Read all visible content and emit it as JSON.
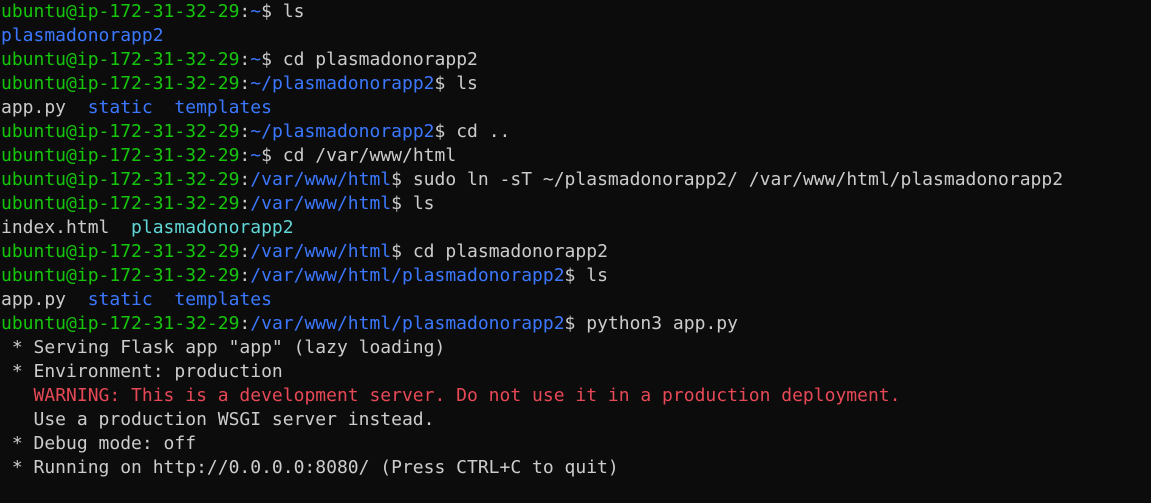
{
  "terminal": {
    "colors": {
      "background": "#0c0c0c",
      "prompt_user": "#16c60c",
      "prompt_path": "#3b78ff",
      "text": "#cccccc",
      "directory": "#3b78ff",
      "symlink": "#61d6d6",
      "warning": "#e74856"
    },
    "lines": [
      [
        {
          "t": "user",
          "v": "ubuntu@ip-172-31-32-29"
        },
        {
          "t": "colon",
          "v": ":"
        },
        {
          "t": "path",
          "v": "~"
        },
        {
          "t": "dollar",
          "v": "$ "
        },
        {
          "t": "cmd",
          "v": "ls"
        }
      ],
      [
        {
          "t": "dir",
          "v": "plasmadonorapp2"
        }
      ],
      [
        {
          "t": "user",
          "v": "ubuntu@ip-172-31-32-29"
        },
        {
          "t": "colon",
          "v": ":"
        },
        {
          "t": "path",
          "v": "~"
        },
        {
          "t": "dollar",
          "v": "$ "
        },
        {
          "t": "cmd",
          "v": "cd plasmadonorapp2"
        }
      ],
      [
        {
          "t": "user",
          "v": "ubuntu@ip-172-31-32-29"
        },
        {
          "t": "colon",
          "v": ":"
        },
        {
          "t": "path",
          "v": "~/plasmadonorapp2"
        },
        {
          "t": "dollar",
          "v": "$ "
        },
        {
          "t": "cmd",
          "v": "ls"
        }
      ],
      [
        {
          "t": "out",
          "v": "app.py  "
        },
        {
          "t": "dir",
          "v": "static"
        },
        {
          "t": "out",
          "v": "  "
        },
        {
          "t": "dir",
          "v": "templates"
        }
      ],
      [
        {
          "t": "user",
          "v": "ubuntu@ip-172-31-32-29"
        },
        {
          "t": "colon",
          "v": ":"
        },
        {
          "t": "path",
          "v": "~/plasmadonorapp2"
        },
        {
          "t": "dollar",
          "v": "$ "
        },
        {
          "t": "cmd",
          "v": "cd .."
        }
      ],
      [
        {
          "t": "user",
          "v": "ubuntu@ip-172-31-32-29"
        },
        {
          "t": "colon",
          "v": ":"
        },
        {
          "t": "path",
          "v": "~"
        },
        {
          "t": "dollar",
          "v": "$ "
        },
        {
          "t": "cmd",
          "v": "cd /var/www/html"
        }
      ],
      [
        {
          "t": "user",
          "v": "ubuntu@ip-172-31-32-29"
        },
        {
          "t": "colon",
          "v": ":"
        },
        {
          "t": "path",
          "v": "/var/www/html"
        },
        {
          "t": "dollar",
          "v": "$ "
        },
        {
          "t": "cmd",
          "v": "sudo ln -sT ~/plasmadonorapp2/ /var/www/html/plasmadonorapp2"
        }
      ],
      [
        {
          "t": "user",
          "v": "ubuntu@ip-172-31-32-29"
        },
        {
          "t": "colon",
          "v": ":"
        },
        {
          "t": "path",
          "v": "/var/www/html"
        },
        {
          "t": "dollar",
          "v": "$ "
        },
        {
          "t": "cmd",
          "v": "ls"
        }
      ],
      [
        {
          "t": "out",
          "v": "index.html  "
        },
        {
          "t": "link",
          "v": "plasmadonorapp2"
        }
      ],
      [
        {
          "t": "user",
          "v": "ubuntu@ip-172-31-32-29"
        },
        {
          "t": "colon",
          "v": ":"
        },
        {
          "t": "path",
          "v": "/var/www/html"
        },
        {
          "t": "dollar",
          "v": "$ "
        },
        {
          "t": "cmd",
          "v": "cd plasmadonorapp2"
        }
      ],
      [
        {
          "t": "user",
          "v": "ubuntu@ip-172-31-32-29"
        },
        {
          "t": "colon",
          "v": ":"
        },
        {
          "t": "path",
          "v": "/var/www/html/plasmadonorapp2"
        },
        {
          "t": "dollar",
          "v": "$ "
        },
        {
          "t": "cmd",
          "v": "ls"
        }
      ],
      [
        {
          "t": "out",
          "v": "app.py  "
        },
        {
          "t": "dir",
          "v": "static"
        },
        {
          "t": "out",
          "v": "  "
        },
        {
          "t": "dir",
          "v": "templates"
        }
      ],
      [
        {
          "t": "user",
          "v": "ubuntu@ip-172-31-32-29"
        },
        {
          "t": "colon",
          "v": ":"
        },
        {
          "t": "path",
          "v": "/var/www/html/plasmadonorapp2"
        },
        {
          "t": "dollar",
          "v": "$ "
        },
        {
          "t": "cmd",
          "v": "python3 app.py"
        }
      ],
      [
        {
          "t": "out",
          "v": " * Serving Flask app \"app\" (lazy loading)"
        }
      ],
      [
        {
          "t": "out",
          "v": " * Environment: production"
        }
      ],
      [
        {
          "t": "out",
          "v": "   "
        },
        {
          "t": "warn",
          "v": "WARNING: This is a development server. Do not use it in a production deployment."
        }
      ],
      [
        {
          "t": "out",
          "v": "   Use a production WSGI server instead."
        }
      ],
      [
        {
          "t": "out",
          "v": " * Debug mode: off"
        }
      ],
      [
        {
          "t": "out",
          "v": " * Running on http://0.0.0.0:8080/ (Press CTRL+C to quit)"
        }
      ]
    ]
  }
}
